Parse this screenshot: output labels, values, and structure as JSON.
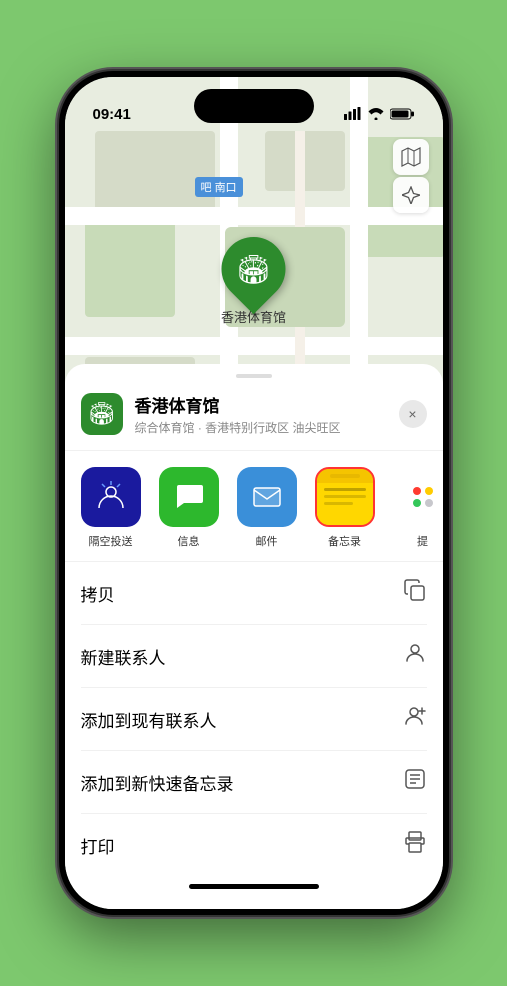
{
  "status": {
    "time": "09:41",
    "signal_icon": "📶",
    "wifi_icon": "wifi",
    "battery_icon": "battery"
  },
  "map": {
    "road_label": "南口",
    "road_label_prefix": "吧",
    "location_pin_label": "香港体育馆",
    "map_icon_label": "🗺",
    "location_btn_label": "↗"
  },
  "location_header": {
    "name": "香港体育馆",
    "sub": "综合体育馆 · 香港特别行政区 油尖旺区",
    "close": "×"
  },
  "share_items": [
    {
      "id": "airdrop",
      "label": "隔空投送",
      "type": "airdrop"
    },
    {
      "id": "message",
      "label": "信息",
      "type": "message"
    },
    {
      "id": "mail",
      "label": "邮件",
      "type": "mail"
    },
    {
      "id": "notes",
      "label": "备忘录",
      "type": "notes"
    },
    {
      "id": "more",
      "label": "提",
      "type": "more"
    }
  ],
  "actions": [
    {
      "id": "copy",
      "label": "拷贝",
      "icon": "copy"
    },
    {
      "id": "new-contact",
      "label": "新建联系人",
      "icon": "person"
    },
    {
      "id": "add-existing",
      "label": "添加到现有联系人",
      "icon": "person-add"
    },
    {
      "id": "add-notes",
      "label": "添加到新快速备忘录",
      "icon": "note"
    },
    {
      "id": "print",
      "label": "打印",
      "icon": "print"
    }
  ],
  "home_indicator_color": "#000"
}
